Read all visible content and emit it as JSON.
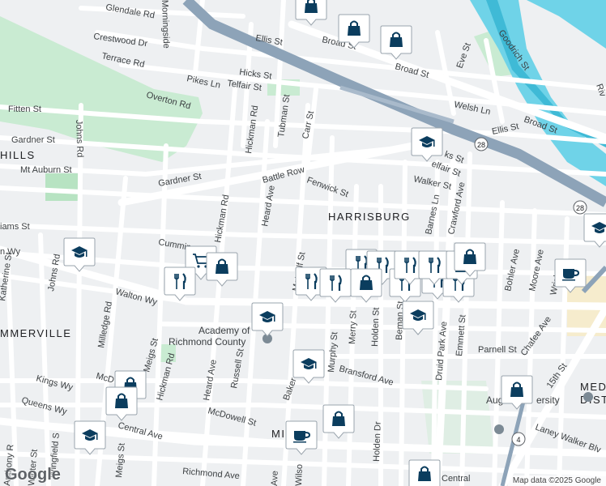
{
  "map": {
    "attribution": "Map data ©2025 Google",
    "logo_text": "Google"
  },
  "colors": {
    "background": "#eef0f2",
    "street": "#ffffff",
    "street_outline": "#d6d9dd",
    "highway": "#8da3b8",
    "water": "#6fd3e8",
    "park": "#c9ebd2",
    "marker": "#0b3d5e"
  },
  "area_labels": [
    {
      "text": "HARRISBURG",
      "kind": "neighborhood"
    },
    {
      "text": "MMERVILLE",
      "kind": "neighborhood"
    },
    {
      "text": "HILLS",
      "kind": "neighborhood"
    },
    {
      "text": "MIL",
      "kind": "neighborhood"
    },
    {
      "text": "MED",
      "kind": "neighborhood"
    },
    {
      "text": "DIST",
      "kind": "neighborhood"
    }
  ],
  "poi_labels": [
    {
      "text": "Academy of"
    },
    {
      "text": "Richmond County"
    },
    {
      "text": "Augusta"
    },
    {
      "text": "ersity"
    }
  ],
  "street_labels": [
    "Glendale Rd",
    "Crestwood Dr",
    "Terrace Rd",
    "Pikes Ln",
    "Overton Rd",
    "Fitten St",
    "Gardner St",
    "Mt Auburn St",
    "Gardner St",
    "Johns Rd",
    "Morningside",
    "Ellis St",
    "Broad St",
    "Broad St",
    "Hicks St",
    "Telfair St",
    "Hickman Rd",
    "Tubman St",
    "Carr St",
    "Battle Row",
    "Fenwick St",
    "Heard Ave",
    "Hickman Rd",
    "Cumming",
    "Walton Wy",
    "Metcalf St",
    "Milledge Rd",
    "Johns Rd",
    "Katherine St",
    "n Wy",
    "iams St",
    "Walker St",
    "Barnes Ln",
    "Crawford Ave",
    "Welsh Ln",
    "Ellis St",
    "Broad St",
    "Eve St",
    "Goodrich St",
    "ks St",
    "elfair St",
    "Bohler Ave",
    "Moore Ave",
    "Wrightsb",
    "Chafee Ave",
    "Parnell St",
    "Emmett St",
    "Druid Park Ave",
    "Beman St",
    "Holden St",
    "Merry St",
    "Murphy St",
    "Bransford Ave",
    "Baker",
    "Russell St",
    "Heard Ave",
    "Hickman Rd",
    "Meigs St",
    "McDowell St",
    "McD",
    "Kings Wy",
    "Queens Wy",
    "Central Ave",
    "Richmond Ave",
    "Winter St",
    "Anthony R",
    "Wingfield S",
    "Meigs St",
    "Holden Dr",
    "Wilso",
    "Ave",
    "15th St",
    "Laney Walker Blv",
    "Central",
    "Riv"
  ],
  "route_shields": [
    "28",
    "28",
    "4"
  ],
  "markers": [
    {
      "icon": "shopping-bag-icon"
    },
    {
      "icon": "shopping-bag-icon"
    },
    {
      "icon": "shopping-bag-icon"
    },
    {
      "icon": "school-icon"
    },
    {
      "icon": "school-icon"
    },
    {
      "icon": "school-icon"
    },
    {
      "icon": "school-icon"
    },
    {
      "icon": "shopping-cart-icon"
    },
    {
      "icon": "shopping-bag-icon"
    },
    {
      "icon": "restaurant-icon"
    },
    {
      "icon": "school-icon"
    },
    {
      "icon": "restaurant-icon"
    },
    {
      "icon": "restaurant-icon"
    },
    {
      "icon": "shopping-bag-icon"
    },
    {
      "icon": "restaurant-icon"
    },
    {
      "icon": "restaurant-icon"
    },
    {
      "icon": "restaurant-icon"
    },
    {
      "icon": "restaurant-icon"
    },
    {
      "icon": "restaurant-icon"
    },
    {
      "icon": "restaurant-icon"
    },
    {
      "icon": "restaurant-icon"
    },
    {
      "icon": "shopping-bag-icon"
    },
    {
      "icon": "shopping-bag-icon"
    },
    {
      "icon": "school-icon"
    },
    {
      "icon": "coffee-icon"
    },
    {
      "icon": "school-icon"
    },
    {
      "icon": "shopping-bag-icon"
    },
    {
      "icon": "shopping-bag-icon"
    },
    {
      "icon": "shopping-bag-icon"
    },
    {
      "icon": "school-icon"
    },
    {
      "icon": "coffee-icon"
    },
    {
      "icon": "shopping-bag-icon"
    },
    {
      "icon": "shopping-bag-icon"
    }
  ]
}
